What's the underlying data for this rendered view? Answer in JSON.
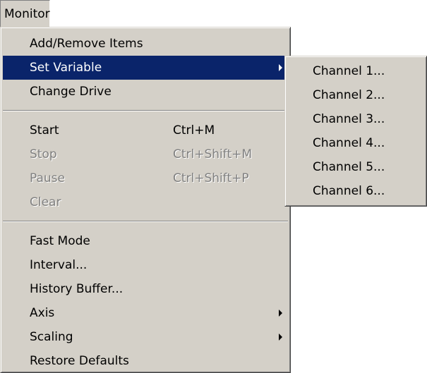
{
  "menubar": {
    "title": "Monitor"
  },
  "monitor_menu": {
    "groups": [
      [
        {
          "label": "Add/Remove Items",
          "shortcut": "",
          "state": "normal"
        },
        {
          "label": "Set Variable",
          "shortcut": "",
          "state": "highlighted",
          "submenu": true
        },
        {
          "label": "Change Drive",
          "shortcut": "",
          "state": "normal"
        }
      ],
      [
        {
          "label": "Start",
          "shortcut": "Ctrl+M",
          "state": "normal"
        },
        {
          "label": "Stop",
          "shortcut": "Ctrl+Shift+M",
          "state": "disabled"
        },
        {
          "label": "Pause",
          "shortcut": "Ctrl+Shift+P",
          "state": "disabled"
        },
        {
          "label": "Clear",
          "shortcut": "",
          "state": "disabled"
        }
      ],
      [
        {
          "label": "Fast Mode",
          "shortcut": "",
          "state": "normal"
        },
        {
          "label": "Interval...",
          "shortcut": "",
          "state": "normal"
        },
        {
          "label": "History Buffer...",
          "shortcut": "",
          "state": "normal"
        },
        {
          "label": "Axis",
          "shortcut": "",
          "state": "normal",
          "submenu": true
        },
        {
          "label": "Scaling",
          "shortcut": "",
          "state": "normal",
          "submenu": true
        },
        {
          "label": "Restore Defaults",
          "shortcut": "",
          "state": "normal"
        }
      ]
    ]
  },
  "set_variable_submenu": {
    "items": [
      {
        "label": "Channel 1..."
      },
      {
        "label": "Channel 2..."
      },
      {
        "label": "Channel 3..."
      },
      {
        "label": "Channel 4..."
      },
      {
        "label": "Channel 5..."
      },
      {
        "label": "Channel 6..."
      }
    ]
  },
  "colors": {
    "menu_face": "#d4d0c8",
    "highlight": "#0a246a",
    "highlight_text": "#ffffff",
    "disabled_text": "#808080"
  },
  "icons": {
    "submenu_arrow": "chevron-right-icon"
  }
}
